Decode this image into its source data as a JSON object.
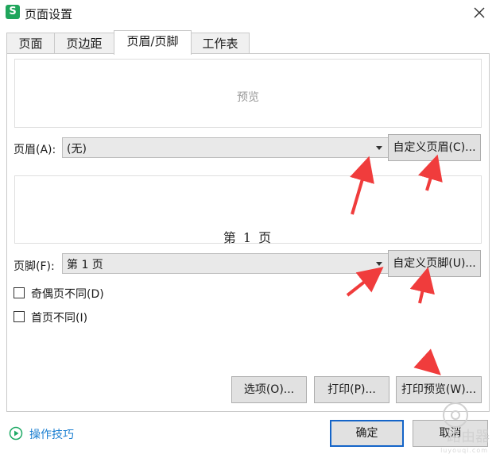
{
  "window": {
    "app_icon_letter": "S",
    "title": "页面设置"
  },
  "tabs": [
    {
      "label": "页面",
      "active": false
    },
    {
      "label": "页边距",
      "active": false
    },
    {
      "label": "页眉/页脚",
      "active": true
    },
    {
      "label": "工作表",
      "active": false
    }
  ],
  "header_preview": {
    "text": "预览"
  },
  "header": {
    "label": "页眉(A):",
    "value": "(无)",
    "custom_button": "自定义页眉(C)..."
  },
  "footer_preview": {
    "text": "第 1 页"
  },
  "footer": {
    "label": "页脚(F):",
    "value": "第 1 页",
    "custom_button": "自定义页脚(U)..."
  },
  "options": {
    "odd_even_different": {
      "label": "奇偶页不同(D)",
      "checked": false
    },
    "first_page_different": {
      "label": "首页不同(I)",
      "checked": false
    }
  },
  "panel_buttons": {
    "options": "选项(O)...",
    "print": "打印(P)...",
    "print_preview": "打印预览(W)..."
  },
  "dialog_buttons": {
    "ok": "确定",
    "cancel": "取消"
  },
  "tips": {
    "label": "操作技巧"
  },
  "watermark": {
    "text": "路由器",
    "sub": "luyouqi.com"
  },
  "colors": {
    "accent": "#1464c8",
    "link": "#1b7fd1",
    "arrow": "#f03c3c",
    "app_icon": "#1fa55b"
  }
}
